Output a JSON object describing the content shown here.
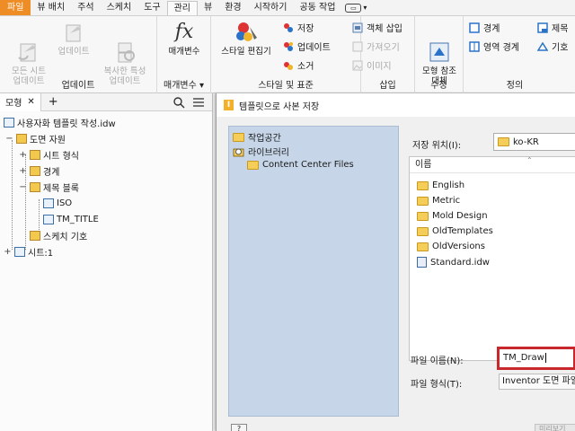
{
  "ribbon_tabs": [
    "파일",
    "뷰 배치",
    "주석",
    "스케치",
    "도구",
    "관리",
    "뷰",
    "환경",
    "시작하기",
    "공동 작업"
  ],
  "active_tab": "관리",
  "ribbon": {
    "update_panel": {
      "title": "업데이트",
      "buttons": [
        "모든 시트\n업데이트",
        "업데이트",
        "복사한 특성\n업데이트"
      ]
    },
    "params_panel": {
      "title": "매개변수 ▾",
      "button": "매개변수"
    },
    "styles_panel": {
      "title": "스타일 및 표준",
      "big_button": "스타일 편집기",
      "small_buttons": [
        "저장",
        "업데이트",
        "소거"
      ]
    },
    "insert_panel": {
      "title": "삽입",
      "small_buttons": [
        "객체 삽입",
        "가져오기",
        "이미지"
      ]
    },
    "modify_panel": {
      "title": "수정",
      "button": "모형 참조\n대체"
    },
    "define_panel": {
      "title": "정의",
      "small_buttons": [
        "경계",
        "영역 경계",
        "제목",
        "기호"
      ]
    }
  },
  "browser": {
    "tab_label": "모형",
    "close_glyph": "✕",
    "add_glyph": "+",
    "tree": [
      {
        "label": "사용자화 템플릿 작성.idw",
        "level": 0,
        "expander": ""
      },
      {
        "label": "도면 자원",
        "level": 1,
        "expander": "−"
      },
      {
        "label": "시트 형식",
        "level": 2,
        "expander": "+"
      },
      {
        "label": "경계",
        "level": 2,
        "expander": "+"
      },
      {
        "label": "제목 블록",
        "level": 2,
        "expander": "−"
      },
      {
        "label": "ISO",
        "level": 3,
        "expander": ""
      },
      {
        "label": "TM_TITLE",
        "level": 3,
        "expander": ""
      },
      {
        "label": "스케치 기호",
        "level": 2,
        "expander": ""
      },
      {
        "label": "시트:1",
        "level": 0,
        "expander": "+"
      }
    ]
  },
  "dialog": {
    "title": "템플릿으로 사본 저장",
    "places": [
      "작업공간",
      "라이브러리",
      "Content Center Files"
    ],
    "save_in_label": "저장 위치(I):",
    "save_in_value": "ko-KR",
    "list_header": "이름",
    "files": [
      "English",
      "Metric",
      "Mold Design",
      "OldTemplates",
      "OldVersions",
      "Standard.idw"
    ],
    "file_name_label": "파일 이름(N):",
    "file_name_value": "TM_Draw",
    "file_type_label": "파일 형식(T):",
    "file_type_value": "Inventor 도면 파일",
    "help_label": "?",
    "preview_label": "미리보기"
  },
  "colors": {
    "file_tab": "#ee8c25",
    "highlight": "#c8282c",
    "places_bg": "#c6d6e8"
  }
}
